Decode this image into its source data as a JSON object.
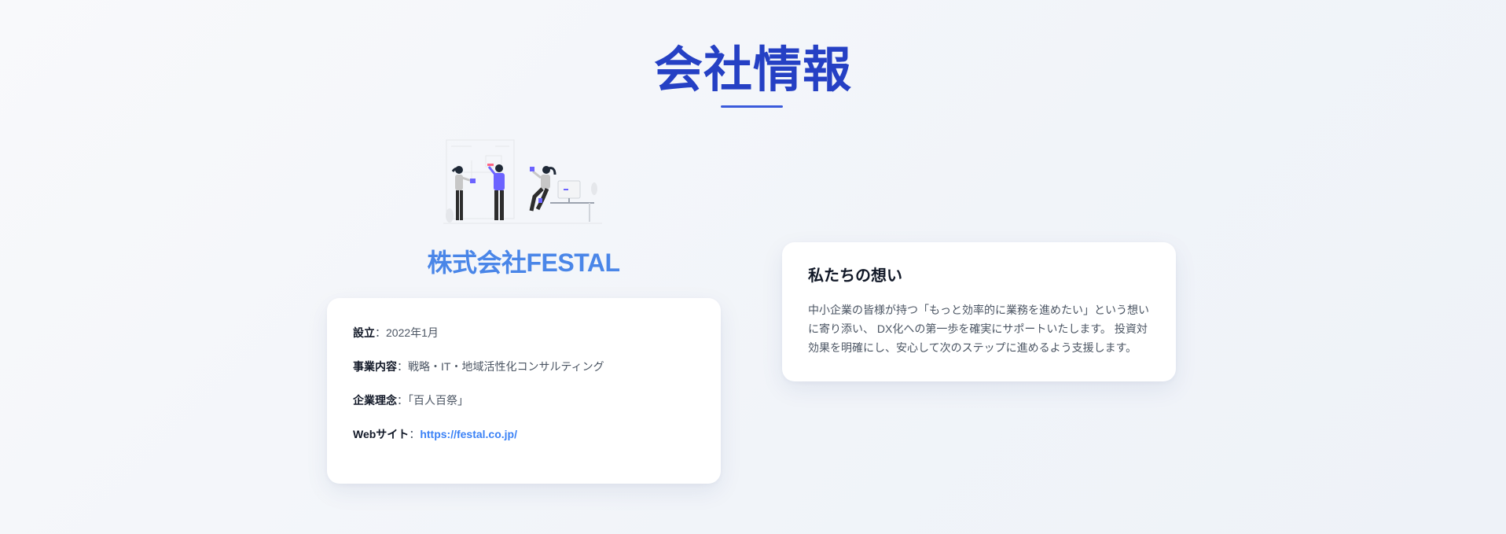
{
  "section": {
    "title": "会社情報"
  },
  "company": {
    "name": "株式会社FESTAL"
  },
  "info": [
    {
      "label": "設立",
      "separator": "：",
      "value": "2022年1月"
    },
    {
      "label": "事業内容",
      "separator": "：",
      "value": "戦略・IT・地域活性化コンサルティング"
    },
    {
      "label": "企業理念",
      "separator": "：",
      "value": "「百人百祭」"
    },
    {
      "label": "Webサイト",
      "separator": "：",
      "value": "https://festal.co.jp/"
    }
  ],
  "mission": {
    "heading": "私たちの想い",
    "text": "中小企業の皆様が持つ「もっと効率的に業務を進めたい」という想いに寄り添い、 DX化への第一歩を確実にサポートいたします。 投資対効果を明確にし、安心して次のステップに進めるよう支援します。"
  },
  "colors": {
    "title": "#2540c4",
    "accent": "#4a86e8",
    "link": "#3b82f6",
    "illustration_accent": "#6c63ff"
  },
  "icons": {
    "illustration": "team-collaboration-illustration"
  }
}
